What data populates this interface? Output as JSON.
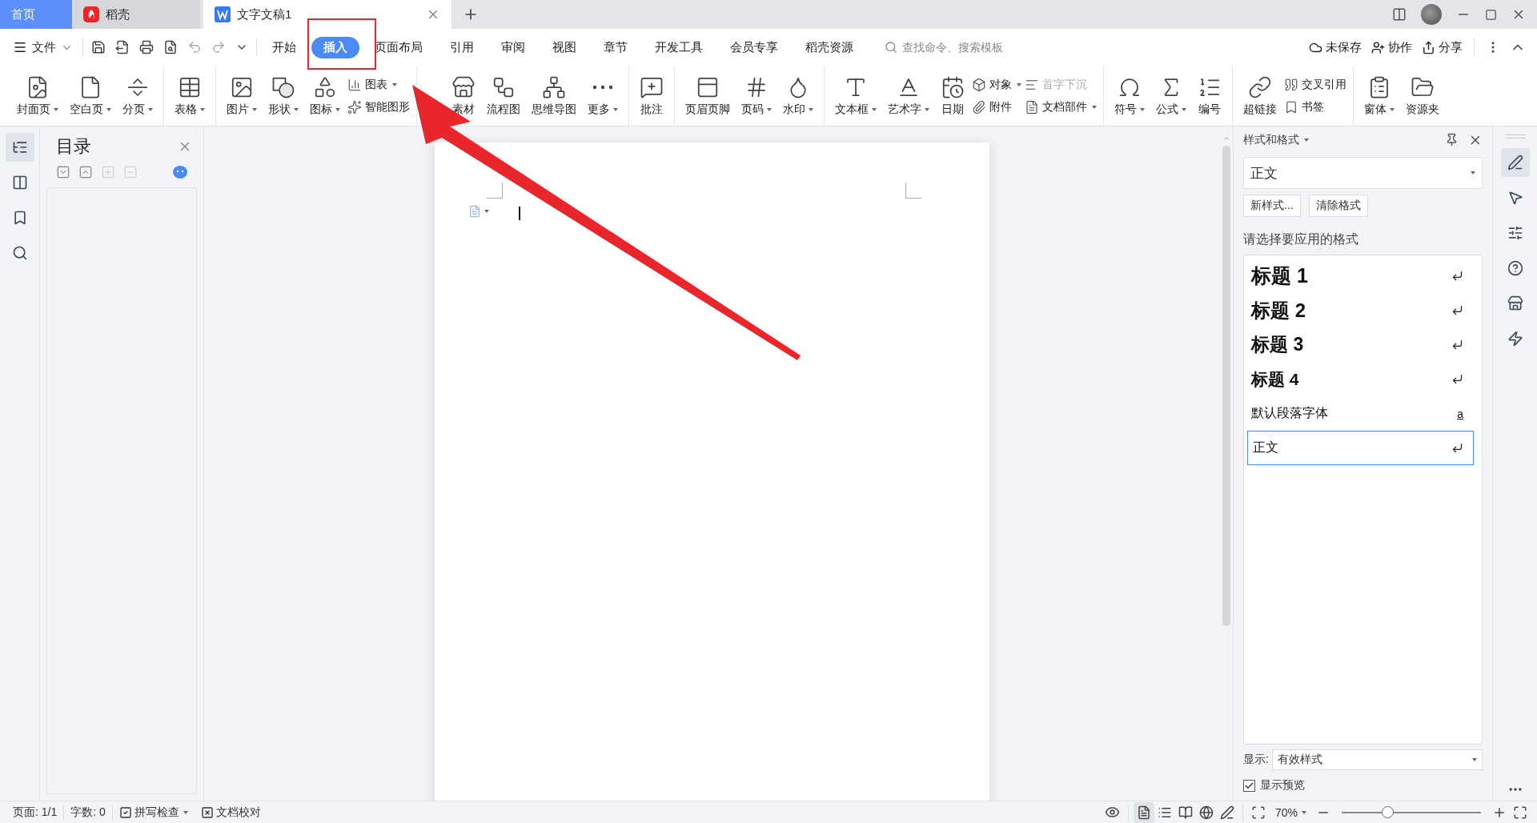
{
  "tabs": [
    {
      "label": "首页",
      "kind": "home",
      "selected": false
    },
    {
      "label": "稻壳",
      "kind": "store",
      "selected": false
    },
    {
      "label": "文字文稿1",
      "kind": "document",
      "selected": true
    }
  ],
  "menu": {
    "file": "文件",
    "tabs": [
      {
        "label": "开始",
        "selected": false
      },
      {
        "label": "插入",
        "selected": true
      },
      {
        "label": "页面布局",
        "selected": false
      },
      {
        "label": "引用",
        "selected": false
      },
      {
        "label": "审阅",
        "selected": false
      },
      {
        "label": "视图",
        "selected": false
      },
      {
        "label": "章节",
        "selected": false
      },
      {
        "label": "开发工具",
        "selected": false
      },
      {
        "label": "会员专享",
        "selected": false
      },
      {
        "label": "稻壳资源",
        "selected": false
      }
    ],
    "search": {
      "placeholder": "查找命令、搜索模板"
    },
    "actions": [
      "未保存",
      "协作",
      "分享"
    ]
  },
  "ribbon": {
    "groups": [
      [
        {
          "kind": "large",
          "label": "封面页",
          "dropdown": true
        },
        {
          "kind": "large",
          "label": "空白页",
          "dropdown": true
        },
        {
          "kind": "large",
          "label": "分页",
          "dropdown": true
        }
      ],
      [
        {
          "kind": "large",
          "label": "表格",
          "dropdown": true
        }
      ],
      [
        {
          "kind": "large",
          "label": "图片",
          "dropdown": true
        },
        {
          "kind": "large",
          "label": "形状",
          "dropdown": true
        },
        {
          "kind": "large",
          "label": "图标",
          "dropdown": true
        },
        {
          "kind": "stack",
          "items": [
            {
              "label": "图表",
              "dropdown": true,
              "disabled": false
            },
            {
              "label": "智能图形",
              "dropdown": false,
              "disabled": false
            }
          ]
        }
      ],
      [
        {
          "kind": "large",
          "label": "素材",
          "dropdown": false
        },
        {
          "kind": "large",
          "label": "流程图",
          "dropdown": false
        },
        {
          "kind": "large",
          "label": "思维导图",
          "dropdown": false
        },
        {
          "kind": "large",
          "label": "更多",
          "dropdown": true
        }
      ],
      [
        {
          "kind": "large",
          "label": "批注",
          "dropdown": false
        }
      ],
      [
        {
          "kind": "large",
          "label": "页眉页脚",
          "dropdown": false
        },
        {
          "kind": "large",
          "label": "页码",
          "dropdown": true
        },
        {
          "kind": "large",
          "label": "水印",
          "dropdown": true
        }
      ],
      [
        {
          "kind": "large",
          "label": "文本框",
          "dropdown": true
        },
        {
          "kind": "large",
          "label": "艺术字",
          "dropdown": true
        },
        {
          "kind": "large",
          "label": "日期",
          "dropdown": false
        },
        {
          "kind": "stack",
          "items": [
            {
              "label": "对象",
              "dropdown": true,
              "disabled": false
            },
            {
              "label": "附件",
              "dropdown": false,
              "disabled": false
            }
          ]
        },
        {
          "kind": "stack",
          "items": [
            {
              "label": "首字下沉",
              "dropdown": false,
              "disabled": true
            },
            {
              "label": "文档部件",
              "dropdown": true,
              "disabled": false
            }
          ]
        }
      ],
      [
        {
          "kind": "large",
          "label": "符号",
          "dropdown": true
        },
        {
          "kind": "large",
          "label": "公式",
          "dropdown": true
        },
        {
          "kind": "large",
          "label": "编号",
          "dropdown": false
        }
      ],
      [
        {
          "kind": "large",
          "label": "超链接",
          "dropdown": false
        },
        {
          "kind": "stack",
          "items": [
            {
              "label": "交叉引用",
              "dropdown": false,
              "disabled": false
            },
            {
              "label": "书签",
              "dropdown": false,
              "disabled": false
            }
          ]
        }
      ],
      [
        {
          "kind": "large",
          "label": "窗体",
          "dropdown": true
        },
        {
          "kind": "large",
          "label": "资源夹",
          "dropdown": false
        }
      ]
    ]
  },
  "left_rail": [
    {
      "selected": true
    },
    {
      "selected": false
    },
    {
      "selected": false
    },
    {
      "selected": false
    }
  ],
  "toc": {
    "title": "目录",
    "tools": [
      {
        "disabled": false
      },
      {
        "disabled": false
      },
      {
        "disabled": true
      },
      {
        "disabled": true
      }
    ]
  },
  "styles_panel": {
    "title": "样式和格式",
    "current": "正文",
    "buttons": [
      "新样式...",
      "清除格式"
    ],
    "prompt": "请选择要应用的格式",
    "styles": [
      {
        "label": "标题 1",
        "kind": "h1",
        "selected": false
      },
      {
        "label": "标题 2",
        "kind": "h2",
        "selected": false
      },
      {
        "label": "标题 3",
        "kind": "h3",
        "selected": false
      },
      {
        "label": "标题 4",
        "kind": "h4",
        "selected": false
      },
      {
        "label": "默认段落字体",
        "kind": "character",
        "mark": "a",
        "selected": false
      },
      {
        "label": "正文",
        "kind": "body",
        "selected": true
      }
    ],
    "show_label": "显示:",
    "show_value": "有效样式",
    "preview": {
      "label": "显示预览",
      "checked": true
    }
  },
  "right_rail": [
    {
      "selected": true
    },
    {
      "selected": false
    },
    {
      "selected": false
    },
    {
      "selected": false
    },
    {
      "selected": false
    },
    {
      "selected": false
    }
  ],
  "status_bar": {
    "page": "页面: 1/1",
    "words": "字数: 0",
    "spell": "拼写检查",
    "proof": "文档校对",
    "views": [
      {
        "selected": true
      },
      {
        "selected": false
      },
      {
        "selected": false
      },
      {
        "selected": false
      }
    ],
    "zoom": "70%",
    "zoom_slider": {
      "level": 0.33
    }
  },
  "annotations": {
    "highlight_box": true,
    "arrow": true
  }
}
